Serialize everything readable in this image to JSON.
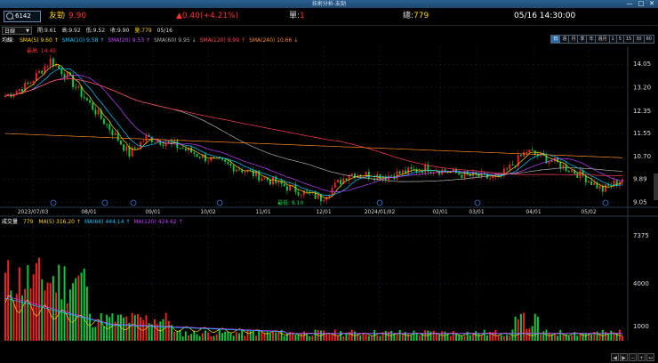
{
  "window": {
    "title": "技術分析-友勁",
    "min": "—",
    "max": "□",
    "close": "✕"
  },
  "quote": {
    "code": "6142",
    "name": "友勁",
    "price": "9.90",
    "change": "▲0.40(+4.21%)",
    "single_label": "單:",
    "single_value": "1",
    "total_label": "總:",
    "total_value": "779",
    "datetime": "05/16 14:30:00"
  },
  "toolbar": {
    "period_select": "日線",
    "stats": {
      "open": "開:9.61",
      "high": "高:9.92",
      "low": "低:9.52",
      "close": "收:9.90",
      "volume": "量:779",
      "date": "05/16"
    },
    "periods": [
      "日",
      "週",
      "月",
      "季",
      "年",
      "週月",
      "1",
      "5",
      "15",
      "30",
      "60"
    ],
    "active_period": "日"
  },
  "ma_legend": {
    "label": "均線:",
    "items": [
      {
        "text": "SMA(5) 9.60",
        "arrow": "↑",
        "color": "#ffd400"
      },
      {
        "text": "SMA(10) 9.58",
        "arrow": "↑",
        "color": "#00c8ff"
      },
      {
        "text": "SMA(20) 9.53",
        "arrow": "↑",
        "color": "#c040ff"
      },
      {
        "text": "SMA(60) 9.95",
        "arrow": "↓",
        "color": "#b0b0b0"
      },
      {
        "text": "SMA(120) 9.99",
        "arrow": "↑",
        "color": "#ff4050"
      },
      {
        "text": "SMA(240) 10.66",
        "arrow": "↓",
        "color": "#ff8a1e"
      }
    ]
  },
  "vol_legend": {
    "label": "成交量",
    "value": "779",
    "items": [
      {
        "text": "MA(5) 316.20",
        "arrow": "↑",
        "color": "#ffd400"
      },
      {
        "text": "MA(66) 444.14",
        "arrow": "↑",
        "color": "#00c8ff"
      },
      {
        "text": "MA(120) 424.62",
        "arrow": "↑",
        "color": "#c040ff"
      }
    ]
  },
  "price_axis": [
    "14.05",
    "13.20",
    "12.35",
    "11.55",
    "10.70",
    "9.89",
    "9.05"
  ],
  "volume_axis": [
    "7375",
    "4000",
    "1000"
  ],
  "date_axis": [
    "2023/07/03",
    "08/01",
    "09/01",
    "10/02",
    "11/01",
    "12/01",
    "2024/01/02",
    "02/01",
    "03/01",
    "04/01",
    "05/02"
  ],
  "annotations": {
    "high": "最高: 14.45",
    "low": "最低: 9.10"
  },
  "colors": {
    "up": "#ff2020",
    "down": "#00d040",
    "flat": "#ffffff",
    "grid": "#1c2a3a"
  }
}
